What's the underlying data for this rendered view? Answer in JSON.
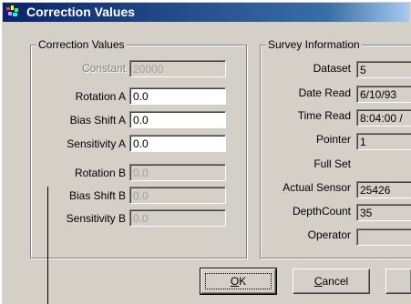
{
  "window": {
    "title": "Correction Values"
  },
  "correction_group": {
    "legend": "Correction Values",
    "rows": [
      {
        "label": "Constant",
        "value": "20000",
        "state": "disabled"
      },
      {
        "label": "Rotation A",
        "value": "0.0",
        "state": "enabled"
      },
      {
        "label": "Bias Shift A",
        "value": "0.0",
        "state": "enabled"
      },
      {
        "label": "Sensitivity A",
        "value": "0.0",
        "state": "enabled"
      },
      {
        "label": "Rotation B",
        "value": "0.0",
        "state": "disabled"
      },
      {
        "label": "Bias Shift B",
        "value": "0.0",
        "state": "disabled"
      },
      {
        "label": "Sensitivity B",
        "value": "0.0",
        "state": "disabled"
      }
    ]
  },
  "survey_group": {
    "legend": "Survey Information",
    "rows": [
      {
        "label": "Dataset",
        "value": "5"
      },
      {
        "label": "Date Read",
        "value": "6/10/93"
      },
      {
        "label": "Time Read",
        "value": "8:04:00 /"
      },
      {
        "label": "Pointer",
        "value": "1"
      },
      {
        "label": "Full Set",
        "value": ""
      },
      {
        "label": "Actual Sensor",
        "value": "25426"
      },
      {
        "label": "DepthCount",
        "value": "35"
      },
      {
        "label": "Operator",
        "value": ""
      }
    ]
  },
  "buttons": {
    "ok": {
      "mnemonic": "O",
      "rest": "K"
    },
    "cancel": {
      "mnemonic": "C",
      "rest": "ancel"
    }
  },
  "colors": {
    "face": "#d4d0c8",
    "title_start": "#0a246a",
    "title_end": "#a6caf0"
  }
}
